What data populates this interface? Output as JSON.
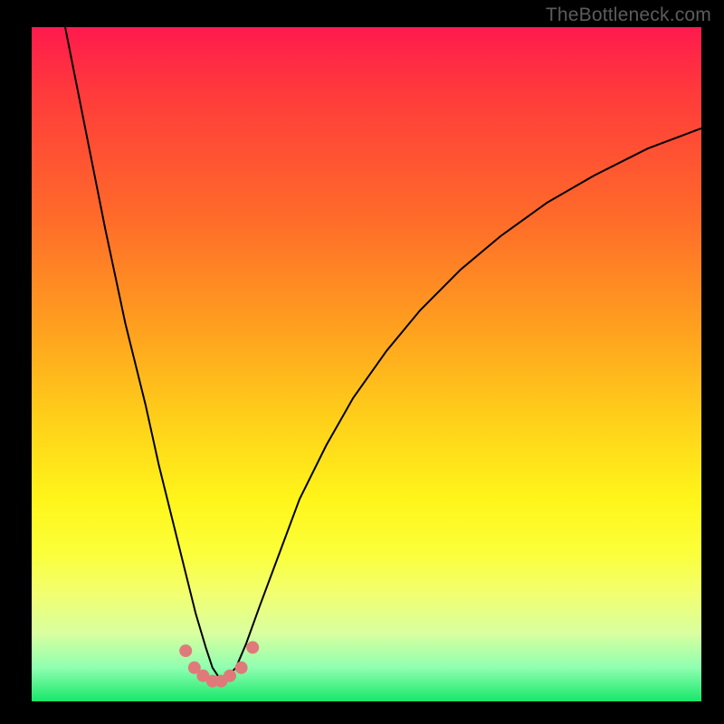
{
  "watermark": "TheBottleneck.com",
  "colors": {
    "frame": "#000000",
    "curve": "#000000",
    "marker_fill": "#e07a7a",
    "gradient_top": "#ff1a4d",
    "gradient_bottom": "#17e66a"
  },
  "chart_data": {
    "type": "line",
    "title": "",
    "xlabel": "",
    "ylabel": "",
    "xlim": [
      0,
      100
    ],
    "ylim": [
      0,
      100
    ],
    "series": [
      {
        "name": "curve",
        "x": [
          5,
          8,
          11,
          14,
          17,
          19,
          21,
          23,
          24.5,
          26,
          27,
          28,
          29,
          30.5,
          32,
          34,
          37,
          40,
          44,
          48,
          53,
          58,
          64,
          70,
          77,
          84,
          92,
          100
        ],
        "y": [
          100,
          85,
          70,
          56,
          44,
          35,
          27,
          19,
          13,
          8,
          5,
          3.5,
          3.5,
          5,
          8.5,
          14,
          22,
          30,
          38,
          45,
          52,
          58,
          64,
          69,
          74,
          78,
          82,
          85
        ]
      }
    ],
    "markers": {
      "name": "highlighted-points",
      "x": [
        23.0,
        24.3,
        25.6,
        27.0,
        28.3,
        29.6,
        31.3,
        33.0
      ],
      "y": [
        7.5,
        5.0,
        3.8,
        3.0,
        3.0,
        3.8,
        5.0,
        8.0
      ]
    },
    "annotations": []
  }
}
